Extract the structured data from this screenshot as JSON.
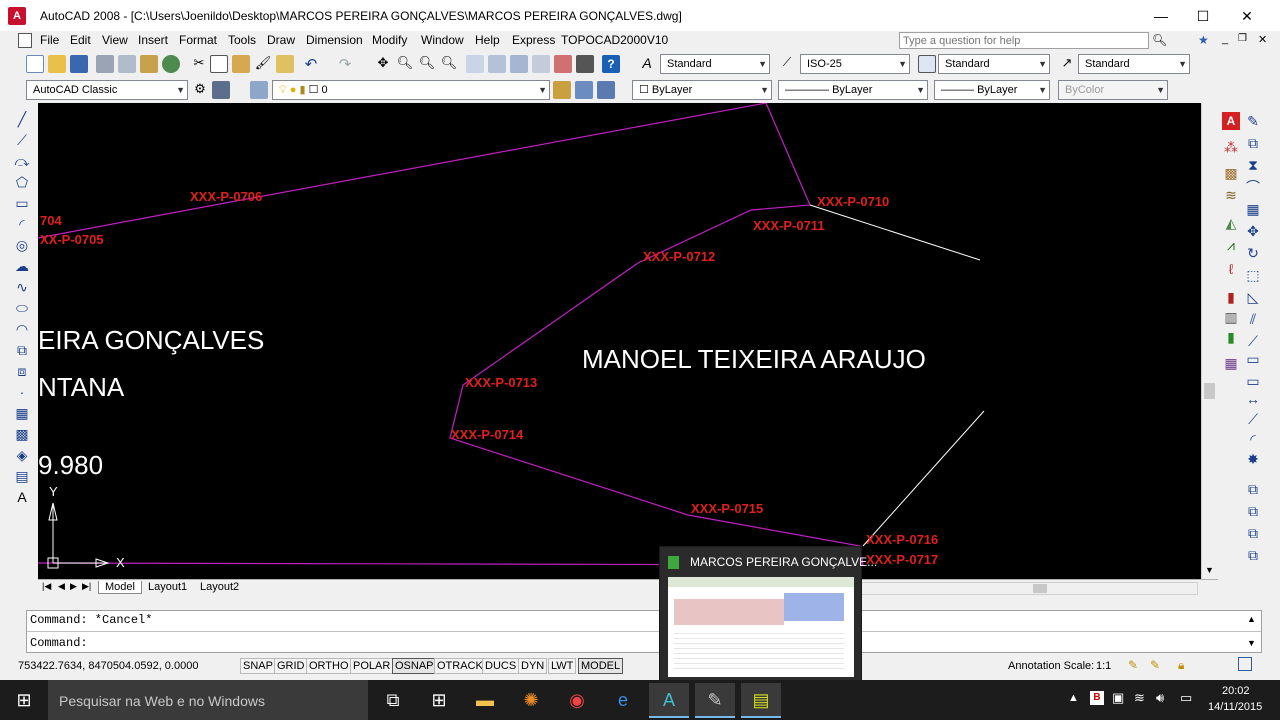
{
  "window": {
    "title": "AutoCAD 2008 - [C:\\Users\\Joenildo\\Desktop\\MARCOS PEREIRA GONÇALVES\\MARCOS PEREIRA GONÇALVES.dwg]",
    "minimize": "—",
    "maximize": "☐",
    "close": "✕"
  },
  "menu": {
    "items": [
      "File",
      "Edit",
      "View",
      "Insert",
      "Format",
      "Tools",
      "Draw",
      "Dimension",
      "Modify",
      "Window",
      "Help",
      "Express",
      "TOPOCAD2000V10"
    ],
    "help_placeholder": "Type a question for help"
  },
  "toolbar": {
    "text_style": "Standard",
    "dim_style": "ISO-25",
    "table_style": "Standard",
    "multileader_style": "Standard",
    "workspace": "AutoCAD Classic",
    "layer": "0",
    "color": "ByLayer",
    "linetype": "ByLayer",
    "lineweight": "ByLayer",
    "plotstyle": "ByColor"
  },
  "drawing": {
    "labels": {
      "p0704": "704",
      "p0705": "XX-P-0705",
      "p0706": "XXX-P-0706",
      "p0710": "XXX-P-0710",
      "p0711": "XXX-P-0711",
      "p0712": "XXX-P-0712",
      "p0713": "XXX-P-0713",
      "p0714": "XXX-P-0714",
      "p0715": "XXX-P-0715",
      "p0716": "XXX-P-0716",
      "p0717": "XXX-P-0717"
    },
    "owner_left_1": "EIRA GONÇALVES",
    "owner_left_2": "NTANA",
    "owner_left_3": "9.980",
    "owner_right": "MANOEL TEIXEIRA ARAUJO",
    "ucs_y": "Y",
    "ucs_x": "X",
    "colors": {
      "boundary": "#c020c0",
      "label": "#e0201c",
      "line": "#ffffff"
    }
  },
  "tabs": {
    "model": "Model",
    "layout1": "Layout1",
    "layout2": "Layout2"
  },
  "command": {
    "line1": "Command: *Cancel*",
    "line2": "Command:"
  },
  "status": {
    "coords": "753422.7634, 8470504.0592, 0.0000",
    "buttons": [
      "SNAP",
      "GRID",
      "ORTHO",
      "POLAR",
      "OSNAP",
      "OTRACK",
      "DUCS",
      "DYN",
      "LWT",
      "MODEL"
    ],
    "annotation_label": "Annotation Scale:",
    "annotation_value": "1:1"
  },
  "thumbnail": {
    "title": "MARCOS PEREIRA GONÇALVE..."
  },
  "taskbar": {
    "search_placeholder": "Pesquisar na Web e no Windows",
    "time": "20:02",
    "date": "14/11/2015"
  }
}
